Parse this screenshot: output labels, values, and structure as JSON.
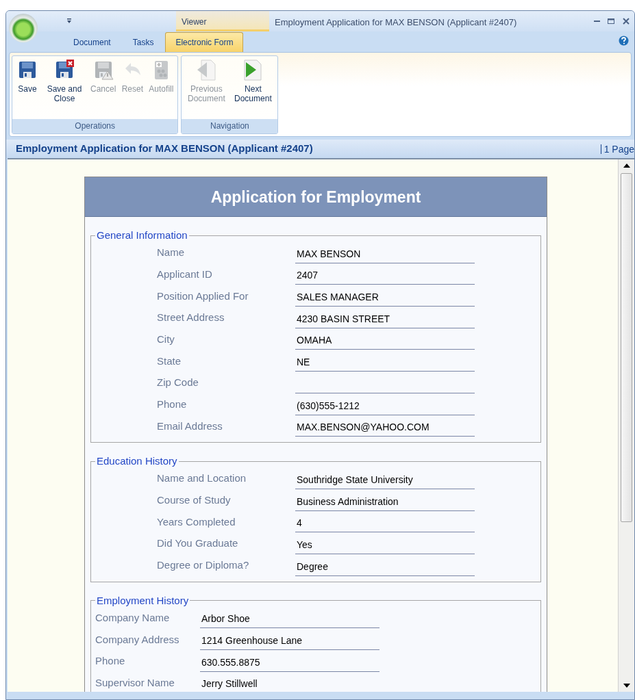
{
  "window": {
    "title": "Employment Application for MAX BENSON (Applicant #2407)",
    "contextual_tab": "Viewer"
  },
  "tabs": [
    {
      "label": "Document",
      "selected": false
    },
    {
      "label": "Tasks",
      "selected": false
    },
    {
      "label": "Electronic Form",
      "selected": true
    }
  ],
  "ribbon": {
    "groups": [
      {
        "label": "Operations",
        "buttons": [
          {
            "label": "Save",
            "kind": "save",
            "disabled": false
          },
          {
            "label": "Save and Close",
            "kind": "save-close",
            "disabled": false
          },
          {
            "label": "Cancel",
            "kind": "cancel",
            "disabled": true
          },
          {
            "label": "Reset",
            "kind": "undo",
            "disabled": true
          },
          {
            "label": "Autofill",
            "kind": "autofill",
            "disabled": true
          }
        ]
      },
      {
        "label": "Navigation",
        "buttons": [
          {
            "label": "Previous Document",
            "kind": "previous",
            "disabled": true
          },
          {
            "label": "Next Document",
            "kind": "next",
            "disabled": false
          }
        ]
      }
    ]
  },
  "document_header": {
    "title": "Employment Application for MAX BENSON (Applicant #2407)",
    "pages": "1 Page"
  },
  "form": {
    "title": "Application for Employment",
    "sections": [
      {
        "title": "General Information",
        "kind": "wide",
        "fields": [
          {
            "label": "Name",
            "value": "MAX BENSON"
          },
          {
            "label": "Applicant ID",
            "value": "2407"
          },
          {
            "label": "Position Applied For",
            "value": "SALES MANAGER"
          },
          {
            "label": "Street Address",
            "value": "4230 BASIN STREET"
          },
          {
            "label": "City",
            "value": "OMAHA"
          },
          {
            "label": "State",
            "value": "NE"
          },
          {
            "label": "Zip Code"
          },
          {
            "label": "Phone",
            "value": "(630)555-1212"
          },
          {
            "label": "Email Address",
            "value": "MAX.BENSON@YAHOO.COM"
          }
        ]
      },
      {
        "title": "Education History",
        "kind": "wide",
        "fields": [
          {
            "label": "Name and Location",
            "value": "Southridge State University"
          },
          {
            "label": "Course of Study",
            "value": "Business Administration"
          },
          {
            "label": "Years Completed",
            "value": "4"
          },
          {
            "label": "Did You Graduate",
            "value": "Yes"
          },
          {
            "label": "Degree or Diploma?",
            "value": "Degree"
          }
        ]
      },
      {
        "title": "Employment History",
        "kind": "compact",
        "fields": [
          {
            "label": "Company Name",
            "value": "Arbor Shoe"
          },
          {
            "label": "Company Address",
            "value": "1214 Greenhouse Lane"
          },
          {
            "label": "Phone",
            "value": "630.555.8875"
          },
          {
            "label": "Supervisor Name",
            "value": "Jerry Stillwell"
          }
        ]
      }
    ]
  }
}
